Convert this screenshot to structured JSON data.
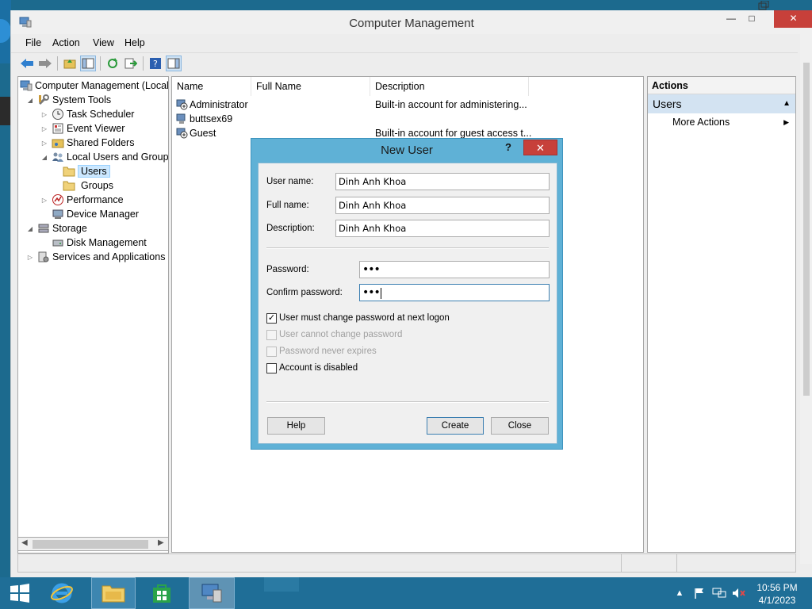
{
  "window": {
    "title": "Computer Management",
    "controls": {
      "minimize": "—",
      "maximize": "□",
      "close": "✕"
    }
  },
  "menu": [
    "File",
    "Action",
    "View",
    "Help"
  ],
  "tree": [
    {
      "label": "Computer Management (Local",
      "icon": "computer-management-icon"
    },
    {
      "label": "System Tools",
      "icon": "tools-icon"
    },
    {
      "label": "Task Scheduler",
      "icon": "clock-icon"
    },
    {
      "label": "Event Viewer",
      "icon": "event-viewer-icon"
    },
    {
      "label": "Shared Folders",
      "icon": "shared-folder-icon"
    },
    {
      "label": "Local Users and Groups",
      "icon": "users-groups-icon"
    },
    {
      "label": "Users",
      "icon": "folder-icon"
    },
    {
      "label": "Groups",
      "icon": "folder-icon"
    },
    {
      "label": "Performance",
      "icon": "performance-icon"
    },
    {
      "label": "Device Manager",
      "icon": "device-manager-icon"
    },
    {
      "label": "Storage",
      "icon": "storage-icon"
    },
    {
      "label": "Disk Management",
      "icon": "disk-icon"
    },
    {
      "label": "Services and Applications",
      "icon": "services-icon"
    }
  ],
  "list": {
    "columns": [
      "Name",
      "Full Name",
      "Description"
    ],
    "rows": [
      {
        "name": "Administrator",
        "full_name": "",
        "description": "Built-in account for administering..."
      },
      {
        "name": "buttsex69",
        "full_name": "",
        "description": ""
      },
      {
        "name": "Guest",
        "full_name": "",
        "description": "Built-in account for guest access t..."
      }
    ]
  },
  "actions": {
    "header": "Actions",
    "section": "Users",
    "items": [
      "More Actions"
    ]
  },
  "dialog": {
    "title": "New User",
    "help_glyph": "?",
    "close_glyph": "✕",
    "fields": {
      "user_name": {
        "label": "User name:",
        "value": "Dinh Anh Khoa"
      },
      "full_name": {
        "label": "Full name:",
        "value": "Dinh Anh Khoa"
      },
      "description": {
        "label": "Description:",
        "value": "Dinh Anh Khoa"
      },
      "password": {
        "label": "Password:",
        "value": "•••"
      },
      "confirm_password": {
        "label": "Confirm password:",
        "value": "•••"
      }
    },
    "checkboxes": {
      "must_change": {
        "label": "User must change password at next logon",
        "checked": true,
        "enabled": true
      },
      "cannot_change": {
        "label": "User cannot change password",
        "checked": false,
        "enabled": false
      },
      "never_expires": {
        "label": "Password never expires",
        "checked": false,
        "enabled": false
      },
      "disabled": {
        "label": "Account is disabled",
        "checked": false,
        "enabled": true
      }
    },
    "buttons": {
      "help": "Help",
      "create": "Create",
      "close": "Close"
    }
  },
  "taskbar": {
    "clock_time": "10:56 PM",
    "clock_date": "4/1/2023",
    "tray_arrow": "▲"
  }
}
